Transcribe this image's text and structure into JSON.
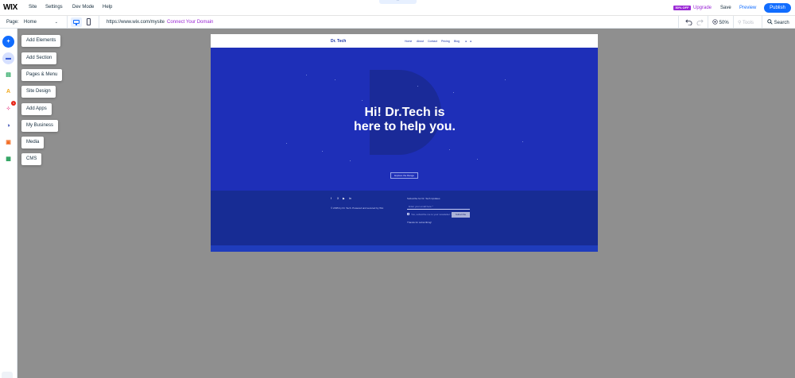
{
  "topbar": {
    "logo": "WIX",
    "menu": [
      "Site",
      "Settings",
      "Dev Mode",
      "Help"
    ],
    "collapse_glyph": "⌃",
    "promo_badge": "50% OFF",
    "upgrade": "Upgrade",
    "save": "Save",
    "preview": "Preview",
    "publish": "Publish"
  },
  "toolbar": {
    "page_label": "Page:",
    "page_value": "Home",
    "page_chevron": "⌄",
    "url": "https://www.wix.com/mysite",
    "connect": "Connect Your Domain",
    "undo_icon": "undo-icon",
    "redo_icon": "redo-icon",
    "zoom": "50%",
    "tools": "Tools",
    "search": "Search"
  },
  "sidebar": {
    "items": [
      {
        "label": "Add Elements",
        "icon": "add-icon",
        "glyph": "+",
        "color": "#116dff",
        "bg": "#116dff"
      },
      {
        "label": "Add Section",
        "icon": "section-icon",
        "glyph": "▬",
        "color": "#3b5fd6",
        "bg": "#d6e0ff"
      },
      {
        "label": "Pages & Menu",
        "icon": "pages-icon",
        "glyph": "▤",
        "color": "#25a55f",
        "bg": "#ffffff"
      },
      {
        "label": "Site Design",
        "icon": "design-icon",
        "glyph": "A",
        "color": "#f0a71a",
        "bg": "#ffffff"
      },
      {
        "label": "Add Apps",
        "icon": "apps-icon",
        "glyph": "⁘",
        "color": "#e3156b",
        "bg": "#ffffff"
      },
      {
        "label": "My Business",
        "icon": "business-icon",
        "glyph": "◑",
        "color": "#1c35a8",
        "bg": "#ffffff"
      },
      {
        "label": "Media",
        "icon": "media-icon",
        "glyph": "▣",
        "color": "#f26b21",
        "bg": "#ffffff"
      },
      {
        "label": "CMS",
        "icon": "cms-icon",
        "glyph": "▦",
        "color": "#1e9b54",
        "bg": "#ffffff"
      }
    ],
    "apps_badge": "1"
  },
  "site": {
    "logo": "Dr. Tech",
    "nav": [
      "Home",
      "About",
      "Contact",
      "Pricing",
      "Blog"
    ],
    "hero_title_line1": "Hi! Dr.Tech is",
    "hero_title_line2": "here to help you.",
    "hero_button": "Explore the Range",
    "footer": {
      "social": [
        "f",
        "X",
        "▶",
        "in"
      ],
      "copyright": "© 2035 by Dr. Tech. Powered and secured by Wix",
      "subscribe_label": "Subscribe for Dr. Tech Updates",
      "email_placeholder": "Enter your email here *",
      "checkbox_label": "Yes, subscribe me to your newsletter. *",
      "subscribe_button": "Subscribe",
      "thanks": "Thanks for subscribing!"
    }
  }
}
